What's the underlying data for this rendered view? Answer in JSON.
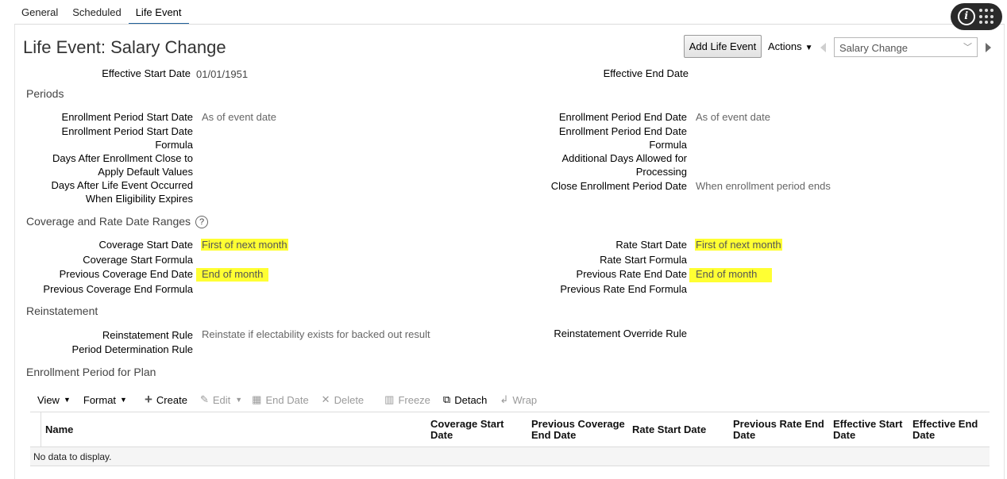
{
  "tabs": [
    "General",
    "Scheduled",
    "Life Event"
  ],
  "header": {
    "title": "Life Event: Salary Change",
    "add_button": "Add Life Event",
    "actions": "Actions",
    "selector_value": "Salary Change"
  },
  "top_fields": {
    "effective_start_label": "Effective Start Date",
    "effective_start_value": "01/01/1951",
    "effective_end_label": "Effective End Date"
  },
  "sections": {
    "periods": "Periods",
    "coverage": "Coverage and Rate Date Ranges",
    "reinstatement": "Reinstatement",
    "enrollment_plan": "Enrollment Period for Plan"
  },
  "periods": {
    "enroll_start_label": "Enrollment Period Start Date",
    "enroll_start_value": "As of event date",
    "enroll_start_formula_l1": "Enrollment Period Start Date",
    "enroll_start_formula_l2": "Formula",
    "days_after_close_l1": "Days After Enrollment Close to",
    "days_after_close_l2": "Apply Default Values",
    "days_after_event_l1": "Days After Life Event Occurred",
    "days_after_event_l2": "When Eligibility Expires",
    "enroll_end_label": "Enrollment Period End Date",
    "enroll_end_value": "As of event date",
    "enroll_end_formula_l1": "Enrollment Period End Date",
    "enroll_end_formula_l2": "Formula",
    "additional_days_l1": "Additional Days Allowed for",
    "additional_days_l2": "Processing",
    "close_enroll_label": "Close Enrollment Period Date",
    "close_enroll_value": "When enrollment period ends"
  },
  "coverage": {
    "coverage_start_label": "Coverage Start Date",
    "coverage_start_value": "First of next month",
    "coverage_start_formula": "Coverage Start Formula",
    "prev_coverage_end_label": "Previous Coverage End Date",
    "prev_coverage_end_value": "End of month",
    "prev_coverage_end_formula": "Previous Coverage End Formula",
    "rate_start_label": "Rate Start Date",
    "rate_start_value": "First of next month",
    "rate_start_formula": "Rate Start Formula",
    "prev_rate_end_label": "Previous Rate End Date",
    "prev_rate_end_value": "End of month",
    "prev_rate_end_formula": "Previous Rate End Formula"
  },
  "reinstatement": {
    "rule_label": "Reinstatement Rule",
    "rule_value": "Reinstate if electability exists for backed out result",
    "period_rule_label": "Period Determination Rule",
    "override_label": "Reinstatement Override Rule"
  },
  "toolbar": {
    "view": "View",
    "format": "Format",
    "create": "Create",
    "edit": "Edit",
    "end_date": "End Date",
    "delete": "Delete",
    "freeze": "Freeze",
    "detach": "Detach",
    "wrap": "Wrap"
  },
  "table": {
    "columns": {
      "name": "Name",
      "coverage_start_l1": "Coverage Start",
      "coverage_start_l2": "Date",
      "prev_coverage_l1": "Previous Coverage",
      "prev_coverage_l2": "End Date",
      "rate_start": "Rate Start Date",
      "prev_rate_l1": "Previous Rate End",
      "prev_rate_l2": "Date",
      "eff_start_l1": "Effective Start",
      "eff_start_l2": "Date",
      "eff_end_l1": "Effective End",
      "eff_end_l2": "Date"
    },
    "empty_message": "No data to display."
  },
  "colors": {
    "highlight": "#ffff33",
    "tab_underline": "#1f5f99"
  }
}
